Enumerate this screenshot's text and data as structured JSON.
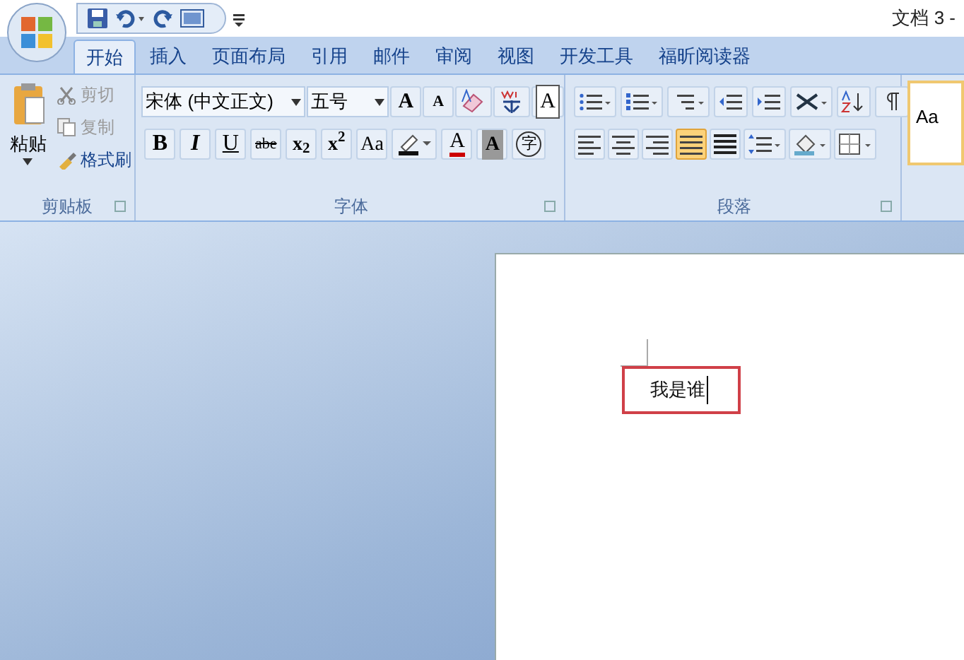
{
  "window": {
    "title": "文档 3 -"
  },
  "tabs": [
    {
      "label": "开始",
      "selected": true
    },
    {
      "label": "插入",
      "selected": false
    },
    {
      "label": "页面布局",
      "selected": false
    },
    {
      "label": "引用",
      "selected": false
    },
    {
      "label": "邮件",
      "selected": false
    },
    {
      "label": "审阅",
      "selected": false
    },
    {
      "label": "视图",
      "selected": false
    },
    {
      "label": "开发工具",
      "selected": false
    },
    {
      "label": "福昕阅读器",
      "selected": false
    }
  ],
  "clipboard": {
    "label": "剪贴板",
    "paste": "粘贴",
    "items": [
      {
        "label": "剪切",
        "disabled": true
      },
      {
        "label": "复制",
        "disabled": true
      },
      {
        "label": "格式刷",
        "disabled": false
      }
    ]
  },
  "font": {
    "label": "字体",
    "font_name": "宋体 (中文正文)",
    "font_size": "五号",
    "row1": [
      {
        "kind": "text",
        "label": "A"
      },
      {
        "kind": "text",
        "label": "A"
      },
      {
        "kind": "icon"
      },
      {
        "kind": "icon"
      },
      {
        "kind": "text",
        "label": "A"
      }
    ],
    "row2": [
      {
        "kind": "text",
        "label": "B"
      },
      {
        "kind": "text",
        "label": "I"
      },
      {
        "kind": "text",
        "label": "U"
      },
      {
        "kind": "text",
        "label": "abe"
      },
      {
        "kind": "text",
        "label": "x$_{2}$"
      },
      {
        "kind": "text",
        "label": "x$^{2}$"
      },
      {
        "kind": "text",
        "label": "Aa"
      },
      {
        "kind": "icon"
      },
      {
        "kind": "text",
        "label": "A"
      },
      {
        "kind": "text",
        "label": "A"
      },
      {
        "kind": "text",
        "label": "字"
      }
    ]
  },
  "paragraph": {
    "label": "段落",
    "alignment": [
      {
        "selected": false
      },
      {
        "selected": false
      },
      {
        "selected": false
      },
      {
        "selected": true
      },
      {
        "selected": false
      }
    ]
  },
  "styles": {
    "preview": "Aa"
  },
  "document": {
    "text": "我是谁",
    "highlighted": true
  }
}
